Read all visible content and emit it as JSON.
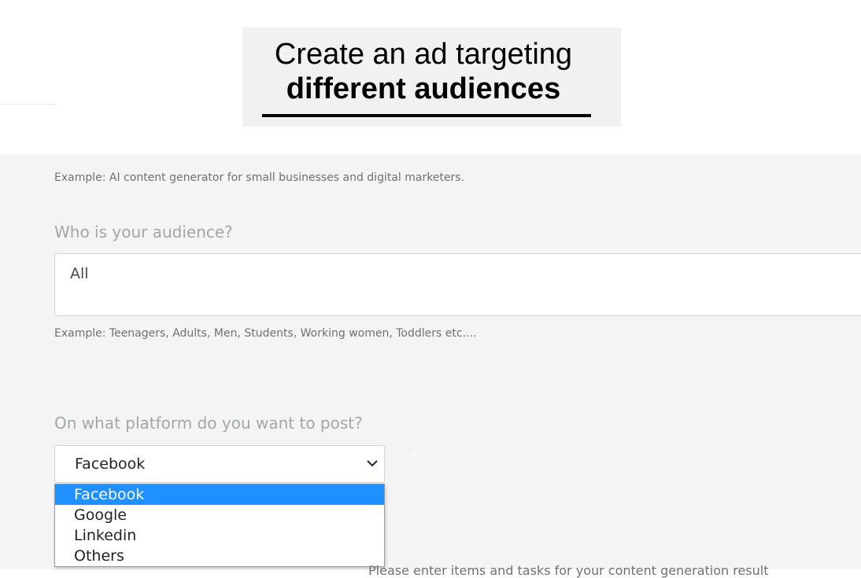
{
  "banner": {
    "line1": "Create an ad targeting",
    "line2": "different audiences"
  },
  "product_hint": "Example: AI content generator for small businesses and digital marketers.",
  "audience": {
    "question": "Who is your audience?",
    "value": "All",
    "hint": "Example: Teenagers, Adults, Men, Students, Working women, Toddlers etc...."
  },
  "platform": {
    "question": "On what platform do you want to post?",
    "selected": "Facebook",
    "options": [
      "Facebook",
      "Google",
      "Linkedin",
      "Others"
    ],
    "highlight_color": "#1e90ff"
  },
  "bottom_partial_text": "Please enter items and tasks for your content generation result"
}
